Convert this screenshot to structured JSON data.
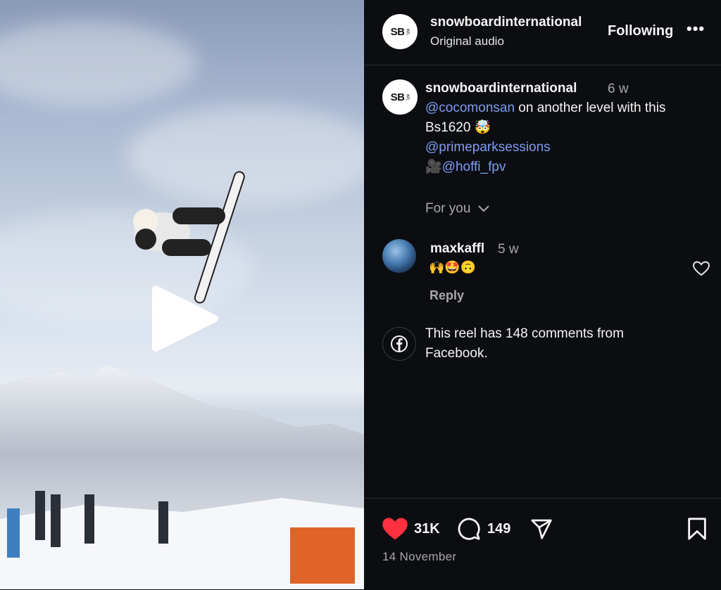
{
  "post": {
    "username": "snowboardinternational",
    "avatar_text": "SB",
    "avatar_subtext": "INTL",
    "audio": "Original audio",
    "follow_label": "Following",
    "more_label": "•••"
  },
  "caption": {
    "username": "snowboardinternational",
    "time": "6 w",
    "mention1": "@cocomonsan",
    "text1": " on another level with this",
    "text2": "Bs1620 🤯",
    "mention2": "@primeparksessions",
    "camera": "🎥",
    "mention3": "@hoffi_fpv"
  },
  "for_you": "For you",
  "comment": {
    "username": "maxkaffl",
    "time": "5 w",
    "text": "🙌🤩🙃",
    "reply_label": "Reply"
  },
  "facebook_note": "This reel has 148 comments from Facebook.",
  "actions": {
    "likes": "31K",
    "comments": "149",
    "date": "14 November"
  },
  "icons": [
    "play-icon",
    "more-icon",
    "chevron-down-icon",
    "heart-outline-icon",
    "facebook-icon",
    "heart-filled-icon",
    "comment-icon",
    "share-icon",
    "bookmark-icon"
  ],
  "colors": {
    "like": "#ff3040",
    "mention": "#7f9cf5",
    "background": "#0b0d10"
  }
}
